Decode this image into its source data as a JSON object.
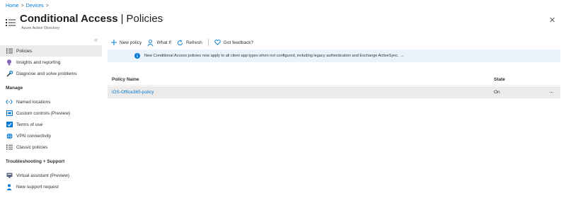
{
  "breadcrumb": {
    "items": [
      "Home",
      "Devices"
    ],
    "separator": ">"
  },
  "header": {
    "title_bold": "Conditional Access",
    "title_sep": "|",
    "title_rest": "Policies",
    "subtitle": "Azure Active Directory",
    "close_icon": "close-icon"
  },
  "sidebar": {
    "collapse_glyph": "«",
    "items": [
      {
        "label": "Policies",
        "icon": "list-icon",
        "active": true
      },
      {
        "label": "Insights and reporting",
        "icon": "lightbulb-icon"
      },
      {
        "label": "Diagnose and solve problems",
        "icon": "wrench-icon"
      }
    ],
    "sections": [
      {
        "title": "Manage",
        "items": [
          {
            "label": "Named locations",
            "icon": "code-icon"
          },
          {
            "label": "Custom controls (Preview)",
            "icon": "custom-controls-icon"
          },
          {
            "label": "Terms of use",
            "icon": "terms-icon"
          },
          {
            "label": "VPN connectivity",
            "icon": "globe-icon"
          },
          {
            "label": "Classic policies",
            "icon": "list-icon"
          }
        ]
      },
      {
        "title": "Troubleshooting + Support",
        "items": [
          {
            "label": "Virtual assistant (Preview)",
            "icon": "assistant-icon"
          },
          {
            "label": "New support request",
            "icon": "person-icon"
          }
        ]
      }
    ]
  },
  "toolbar": {
    "new_policy": "New policy",
    "what_if": "What If",
    "refresh": "Refresh",
    "feedback": "Got feedback?"
  },
  "banner": {
    "text": "New Conditional Access policies now apply to all client app types when not configured, including legacy authentication and Exchange ActiveSync. →"
  },
  "table": {
    "columns": [
      "Policy Name",
      "State"
    ],
    "rows": [
      {
        "name": "iOS-Office365-policy",
        "state": "On",
        "more": "···"
      }
    ]
  },
  "colors": {
    "accent": "#0078d4",
    "active_bg": "#edebe9",
    "banner_bg": "#eaf3fb"
  }
}
